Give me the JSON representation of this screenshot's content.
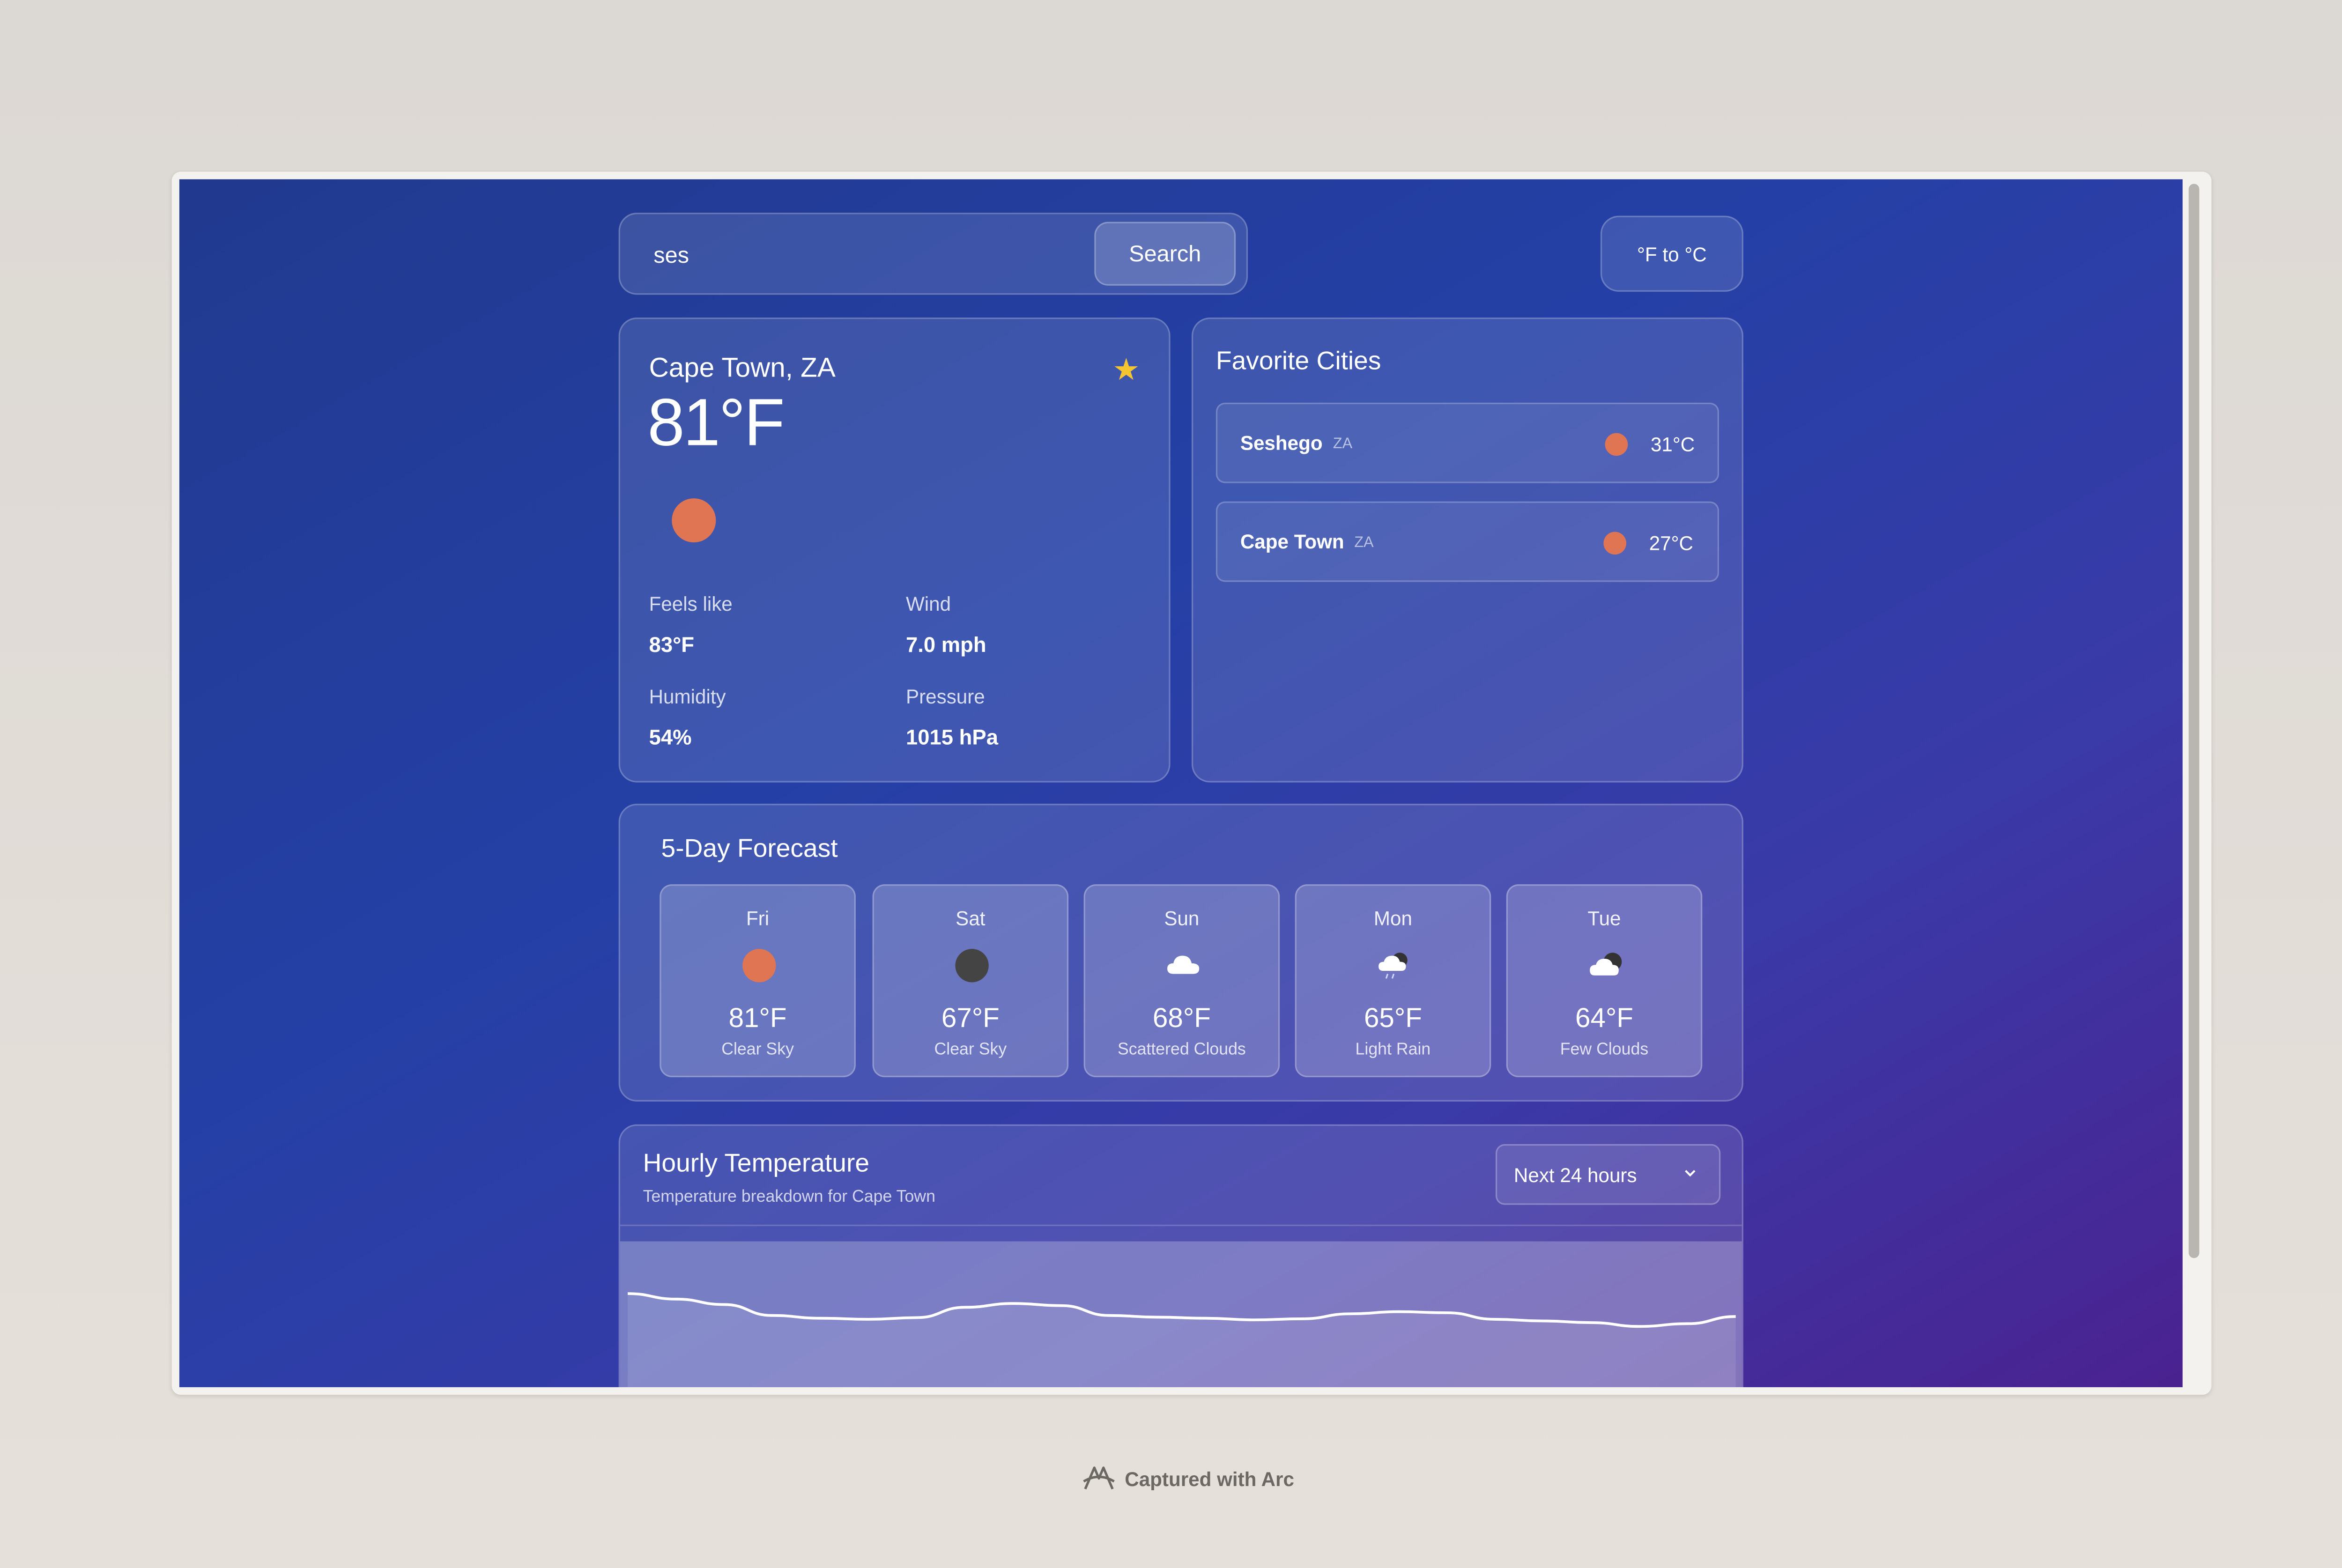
{
  "search": {
    "value": "ses",
    "button_label": "Search"
  },
  "unit_toggle": {
    "label": "°F to °C"
  },
  "current": {
    "city": "Cape Town, ZA",
    "temperature": "81°F",
    "favorited": true,
    "metrics": [
      {
        "label": "Feels like",
        "value": "83°F"
      },
      {
        "label": "Wind",
        "value": "7.0 mph"
      },
      {
        "label": "Humidity",
        "value": "54%"
      },
      {
        "label": "Pressure",
        "value": "1015 hPa"
      }
    ]
  },
  "favorites": {
    "title": "Favorite Cities",
    "items": [
      {
        "name": "Seshego",
        "country": "ZA",
        "temp": "31°C"
      },
      {
        "name": "Cape Town",
        "country": "ZA",
        "temp": "27°C"
      }
    ]
  },
  "forecast": {
    "title": "5-Day Forecast",
    "days": [
      {
        "day": "Fri",
        "temp": "81°F",
        "desc": "Clear Sky",
        "icon": "sun-icon"
      },
      {
        "day": "Sat",
        "temp": "67°F",
        "desc": "Clear Sky",
        "icon": "moon-icon"
      },
      {
        "day": "Sun",
        "temp": "68°F",
        "desc": "Scattered Clouds",
        "icon": "cloud-icon"
      },
      {
        "day": "Mon",
        "temp": "65°F",
        "desc": "Light Rain",
        "icon": "rain-cloud-icon"
      },
      {
        "day": "Tue",
        "temp": "64°F",
        "desc": "Few Clouds",
        "icon": "cloud-moon-icon"
      }
    ]
  },
  "hourly": {
    "title": "Hourly Temperature",
    "subtitle": "Temperature breakdown for Cape Town",
    "range_label": "Next 24 hours"
  },
  "chart_data": {
    "type": "area",
    "title": "Hourly Temperature",
    "series": [
      {
        "values": [
          81,
          80,
          79,
          77,
          76.5,
          76.3,
          76.6,
          78.5,
          79.2,
          78.8,
          77,
          76.7,
          76.5,
          76.2,
          76.4,
          77.3,
          77.7,
          77.5,
          76.3,
          76,
          75.7,
          75,
          75.5,
          76.8
        ]
      }
    ]
  },
  "footer": {
    "badge": "Captured with Arc"
  },
  "colors": {
    "sun": "#e07554",
    "star": "#f5c531",
    "moon": "#444444"
  }
}
